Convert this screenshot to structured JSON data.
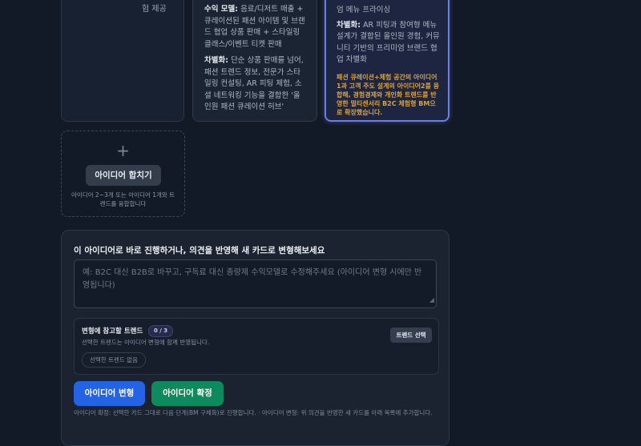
{
  "cards": {
    "left_tail": "운 쇼핑 경험 제공",
    "mid": {
      "revenue_label": "수익 모델:",
      "revenue_text": "음료/디저트 매출 + 큐레이션된 패션 아이템 및 브랜드 협업 상품 판매 + 스타일링 클래스/이벤트 티켓 판매",
      "diff_label": "차별화:",
      "diff_text": "단순 상품 판매를 넘어, 패션 트렌드 정보, 전문가 스타일링 컨설팅, AR 피팅 체험, 소셜 네트워킹 기능을 결합한 '올인원 패션 큐레이션 허브'"
    },
    "selected": {
      "top_text": "엄 메뉴 프라이싱",
      "diff_label": "차별화:",
      "diff_text": "AR 피팅과 참여형 메뉴 설계가 결합된 올인원 경험, 커뮤니티 기반의 프리미엄 브랜드 협업 차별화",
      "note": "패션 큐레이션+체험 공간의 아이디어1과 고객 주도 설계의 아이디어2를 융합해, 경험경제와 개인화 트렌드를 반영한 멀티센서리 B2C 체험형 BM으로 확장했습니다."
    }
  },
  "merge": {
    "plus": "+",
    "button": "아이디어 합치기",
    "help": "아이디어 2~3개 또는 아이디어 1개와 트렌드를 융합합니다"
  },
  "panel": {
    "title": "이 아이디어로 바로 진행하거나, 의견을 반영해 새 카드로 변형해보세요",
    "placeholder": "예: B2C 대신 B2B로 바꾸고, 구독료 대신 종량제 수익모델로 수정해주세요 (아이디어 변형 시에만 반영됩니다)",
    "trend": {
      "title": "변형에 참고할 트렌드",
      "count": "0 / 3",
      "subtitle": "선택한 트렌드는 아이디어 변형에 함께 반영됩니다.",
      "empty": "선택한 트렌드 없음",
      "select_button": "트렌드 선택"
    },
    "transform_button": "아이디어 변형",
    "confirm_button": "아이디어 확정",
    "footnote": "아이디어 확정: 선택한 카드 그대로 다음 단계(BM 구체화)로 진행합니다. · 아이디어 변형: 위 의견을 반영한 새 카드를 아래 목록에 추가합니다."
  }
}
